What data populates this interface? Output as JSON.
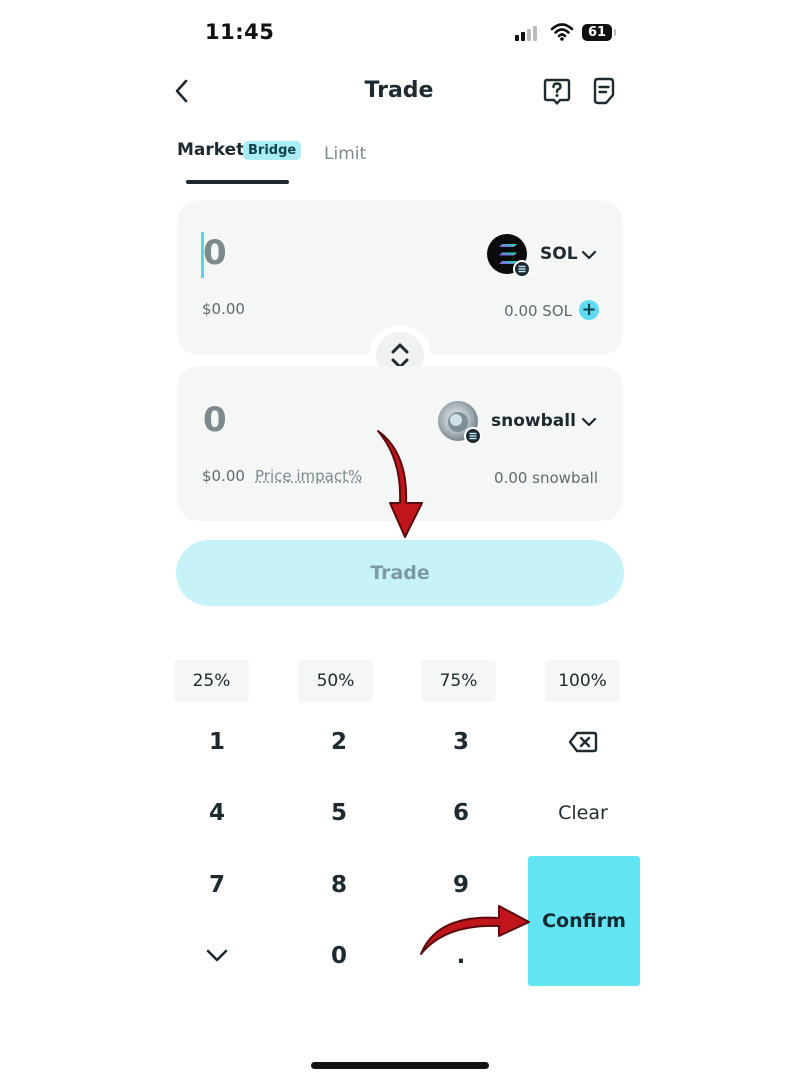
{
  "status_bar": {
    "time": "11:45",
    "battery": "61"
  },
  "header": {
    "title": "Trade"
  },
  "tabs": {
    "market": "Market",
    "bridge_badge": "Bridge",
    "limit": "Limit"
  },
  "pay": {
    "amount": "0",
    "usd": "$0.00",
    "token": "SOL",
    "balance": "0.00 SOL"
  },
  "receive": {
    "amount": "0",
    "usd": "$0.00",
    "price_impact_label": "Price impact%",
    "token": "snowball",
    "balance": "0.00 snowball"
  },
  "trade_button": "Trade",
  "percent_buttons": [
    "25%",
    "50%",
    "75%",
    "100%"
  ],
  "keypad": {
    "k1": "1",
    "k2": "2",
    "k3": "3",
    "k4": "4",
    "k5": "5",
    "k6": "6",
    "k7": "7",
    "k8": "8",
    "k9": "9",
    "k0": "0",
    "dot": ".",
    "clear": "Clear",
    "confirm": "Confirm"
  },
  "colors": {
    "accent": "#63e4f2",
    "trade_button_bg": "#c6f3f8",
    "annotation_arrow": "#c0161b"
  },
  "icons": [
    "back-icon",
    "help-icon",
    "history-icon",
    "chevron-down-icon",
    "swap-icon",
    "backspace-icon",
    "plus-icon"
  ]
}
